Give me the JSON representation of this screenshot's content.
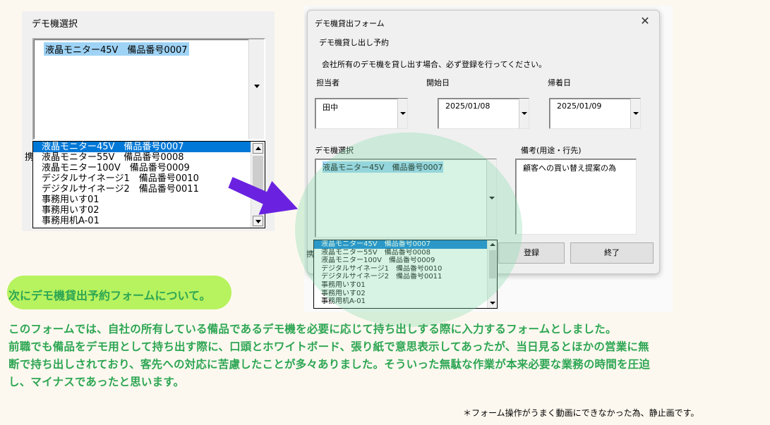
{
  "left_screenshot": {
    "caption": "デモ機選択",
    "selected_value": "液晶モニター45V　備品番号0007",
    "stub_label": "携",
    "dropdown_items": [
      "液晶モニター45V　備品番号0007",
      "液晶モニター55V　備品番号0008",
      "液晶モニター100V　備品番号0009",
      "デジタルサイネージ1　備品番号0010",
      "デジタルサイネージ2　備品番号0011",
      "事務用いす01",
      "事務用いす02",
      "事務用机A-01"
    ],
    "selected_index": 0
  },
  "form": {
    "title": "デモ機貸出フォーム",
    "close_label": "✕",
    "subtitle": "デモ機貸し出し予約",
    "notice": "会社所有のデモ機を貸し出す場合、必ず登録を行ってください。",
    "person_label": "担当者",
    "person_value": "田中",
    "start_label": "開始日",
    "start_value": "2025/01/08",
    "return_label": "帰着日",
    "return_value": "2025/01/09",
    "device_label": "デモ機選択",
    "device_value": "液晶モニター45V　備品番号0007",
    "remarks_label": "備考(用途・行先)",
    "remarks_value": "顧客への買い替え提案の為",
    "register_button": "登録",
    "exit_button": "終了",
    "stub_label": "携",
    "dropdown_items": [
      "液晶モニター45V　備品番号0007",
      "液晶モニター55V　備品番号0008",
      "液晶モニター100V　備品番号0009",
      "デジタルサイネージ1　備品番号0010",
      "デジタルサイネージ2　備品番号0011",
      "事務用いす01",
      "事務用いす02",
      "事務用机A-01"
    ]
  },
  "text": {
    "heading": "次にデモ機貸出予約フォームについて。",
    "paragraph_lines": [
      "このフォームでは、自社の所有している備品であるデモ機を必要に応じて持ち出しする際に入力するフォームとしました。",
      "前職でも備品をデモ用として持ち出す際に、口頭とホワイトボード、張り紙で意思表示してあったが、当日見るとほかの営業に無",
      "断で持ち出しされており、客先への対応に苦慮したことが多々ありました。そういった無駄な作業が本来必要な業務の時間を圧迫",
      "し、マイナスであったと思います。"
    ],
    "footnote": "＊フォーム操作がうまく動画にできなかった為、静止画です。"
  },
  "colors": {
    "accent_green": "#2da653",
    "pill_green": "#b7f25f",
    "arrow_purple": "#6a22e0",
    "selection_blue": "#0078d7"
  }
}
